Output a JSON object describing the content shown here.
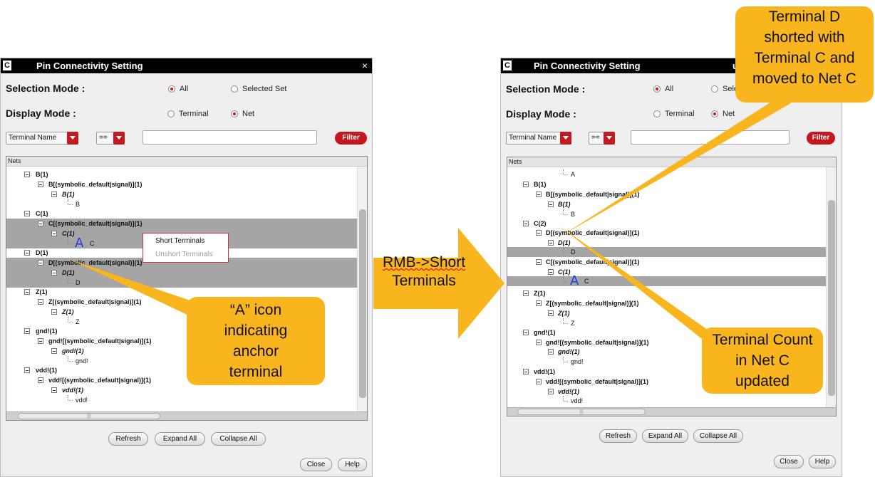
{
  "dialog_title": "Pin Connectivity Setting",
  "right_title_fragment": "u",
  "selection_mode_label": "Selection Mode :",
  "display_mode_label": "Display Mode :",
  "radio_all": "All",
  "radio_selected_set": "Selected Set",
  "radio_selected_set_truncated": "Selec",
  "radio_terminal": "Terminal",
  "radio_net": "Net",
  "filter": {
    "field_combo": "Terminal Name",
    "operator_combo": "==",
    "value": "",
    "button": "Filter"
  },
  "tree_header": "Nets",
  "left_tree": [
    {
      "text": "B(1)",
      "style": "bold"
    },
    {
      "text": "B[(symbolic_default|signal)](1)",
      "style": "bold"
    },
    {
      "text": "B(1)",
      "style": "ital"
    },
    {
      "text": "B",
      "style": "plain"
    },
    {
      "text": "C(1)",
      "style": "bold"
    },
    {
      "text": "C[(symbolic_default|signal)](1)",
      "style": "bold"
    },
    {
      "text": "C(1)",
      "style": "ital"
    },
    {
      "text": "C",
      "style": "plain"
    },
    {
      "text": "D(1)",
      "style": "bold"
    },
    {
      "text": "D[(symbolic_default|signal)](1)",
      "style": "bold"
    },
    {
      "text": "D(1)",
      "style": "ital"
    },
    {
      "text": "D",
      "style": "plain"
    },
    {
      "text": "Z(1)",
      "style": "bold"
    },
    {
      "text": "Z[(symbolic_default|signal)](1)",
      "style": "bold"
    },
    {
      "text": "Z(1)",
      "style": "ital"
    },
    {
      "text": "Z",
      "style": "plain"
    },
    {
      "text": "gnd!(1)",
      "style": "bold"
    },
    {
      "text": "gnd![(symbolic_default|signal)](1)",
      "style": "bold"
    },
    {
      "text": "gnd!(1)",
      "style": "ital"
    },
    {
      "text": "gnd!",
      "style": "plain"
    },
    {
      "text": "vdd!(1)",
      "style": "bold"
    },
    {
      "text": "vdd![(symbolic_default|signal)](1)",
      "style": "bold"
    },
    {
      "text": "vdd!(1)",
      "style": "ital"
    },
    {
      "text": "vdd!",
      "style": "plain"
    }
  ],
  "right_tree": [
    {
      "text": "A",
      "style": "plain"
    },
    {
      "text": "B(1)",
      "style": "bold"
    },
    {
      "text": "B[(symbolic_default|signal)](1)",
      "style": "bold"
    },
    {
      "text": "B(1)",
      "style": "ital"
    },
    {
      "text": "B",
      "style": "plain"
    },
    {
      "text": "C(2)",
      "style": "bold"
    },
    {
      "text": "D[(symbolic_default|signal)](1)",
      "style": "bold"
    },
    {
      "text": "D(1)",
      "style": "ital"
    },
    {
      "text": "D",
      "style": "plain"
    },
    {
      "text": "C[(symbolic_default|signal)](1)",
      "style": "bold"
    },
    {
      "text": "C(1)",
      "style": "ital"
    },
    {
      "text": "C",
      "style": "plain"
    },
    {
      "text": "Z(1)",
      "style": "bold"
    },
    {
      "text": "Z[(symbolic_default|signal)](1)",
      "style": "bold"
    },
    {
      "text": "Z(1)",
      "style": "ital"
    },
    {
      "text": "Z",
      "style": "plain"
    },
    {
      "text": "gnd!(1)",
      "style": "bold"
    },
    {
      "text": "gnd![(symbolic_default|signal)](1)",
      "style": "bold"
    },
    {
      "text": "gnd!(1)",
      "style": "ital"
    },
    {
      "text": "gnd!",
      "style": "plain"
    },
    {
      "text": "vdd!(1)",
      "style": "bold"
    },
    {
      "text": "vdd![(symbolic_default|signal)](1)",
      "style": "bold"
    },
    {
      "text": "vdd!(1)",
      "style": "ital"
    },
    {
      "text": "vdd!",
      "style": "plain"
    }
  ],
  "anchor_icon_letter": "A",
  "context_menu": {
    "short": "Short Terminals",
    "unshort": "Unshort Terminals"
  },
  "buttons": {
    "refresh": "Refresh",
    "expand_all": "Expand All",
    "collapse_all": "Collapse All",
    "close": "Close",
    "help": "Help"
  },
  "close_glyph": "×",
  "scroll_grip": "|||",
  "annotations": {
    "anchor_callout": "“A” icon indicating anchor terminal",
    "rmb_action_line1": "RMB->Short",
    "rmb_action_line2": "Terminals",
    "shorted_callout": "Terminal D shorted with Terminal C and moved to Net C",
    "count_callout": "Terminal Count in Net C updated"
  },
  "colors": {
    "callout": "#f9b51e",
    "accent_red": "#c5161d",
    "selection_gray": "#a5a5a5"
  }
}
